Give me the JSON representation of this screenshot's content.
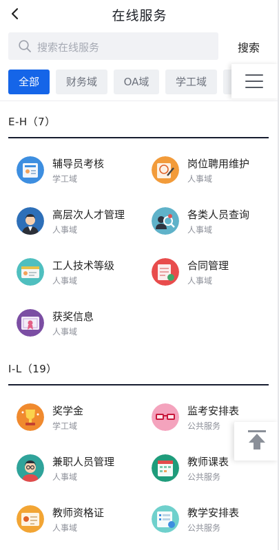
{
  "header": {
    "title": "在线服务"
  },
  "search": {
    "placeholder": "搜索在线服务",
    "button_label": "搜索"
  },
  "tabs": [
    {
      "label": "全部",
      "active": true
    },
    {
      "label": "财务域",
      "active": false
    },
    {
      "label": "OA域",
      "active": false
    },
    {
      "label": "学工域",
      "active": false
    },
    {
      "label": "",
      "active": false
    }
  ],
  "sections": [
    {
      "title": "E-H（7）",
      "items": [
        {
          "name": "辅导员考核",
          "domain": "学工域",
          "icon": "counselor-assessment-icon"
        },
        {
          "name": "岗位聘用维护",
          "domain": "人事域",
          "icon": "job-hiring-icon"
        },
        {
          "name": "高层次人才管理",
          "domain": "人事域",
          "icon": "senior-talent-icon"
        },
        {
          "name": "各类人员查询",
          "domain": "人事域",
          "icon": "personnel-search-icon"
        },
        {
          "name": "工人技术等级",
          "domain": "人事域",
          "icon": "worker-grade-icon"
        },
        {
          "name": "合同管理",
          "domain": "人事域",
          "icon": "contract-icon"
        },
        {
          "name": "获奖信息",
          "domain": "人事域",
          "icon": "award-certificate-icon"
        }
      ]
    },
    {
      "title": "I-L（19）",
      "items": [
        {
          "name": "奖学金",
          "domain": "学工域",
          "icon": "scholarship-trophy-icon"
        },
        {
          "name": "监考安排表",
          "domain": "公共服务",
          "icon": "invigilation-glasses-icon"
        },
        {
          "name": "兼职人员管理",
          "domain": "人事域",
          "icon": "part-time-staff-icon"
        },
        {
          "name": "教师课表",
          "domain": "公共服务",
          "icon": "teacher-timetable-icon"
        },
        {
          "name": "教师资格证",
          "domain": "人事域",
          "icon": "teacher-certificate-icon"
        },
        {
          "name": "教学安排表",
          "domain": "公共服务",
          "icon": "teaching-schedule-icon"
        }
      ]
    }
  ],
  "colors": {
    "accent": "#1565e8",
    "section_rule": "#151b2e"
  }
}
